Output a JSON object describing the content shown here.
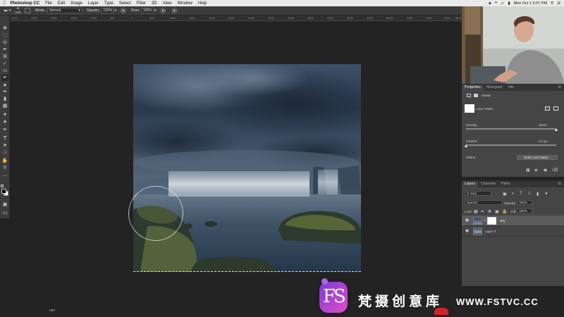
{
  "menubar": {
    "app_name": "Photoshop CC",
    "items": [
      "File",
      "Edit",
      "Image",
      "Layer",
      "Type",
      "Select",
      "Filter",
      "3D",
      "View",
      "Window",
      "Help"
    ],
    "clock": "Mon Oct 1  5:57 PM"
  },
  "options_bar": {
    "brush_size": "1800",
    "mode_label": "Mode:",
    "mode_value": "Normal",
    "opacity_label": "Opacity:",
    "opacity_value": "100%",
    "flow_label": "Flow:",
    "flow_value": "100%"
  },
  "ruler": {
    "ticks": [
      "3000",
      "2500",
      "2000",
      "1500",
      "1000",
      "500",
      "0",
      "500",
      "1000",
      "1500",
      "2000",
      "2500",
      "3000",
      "3500",
      "4000",
      "4500",
      "5000",
      "5500",
      "6000",
      "6500",
      "7000",
      "7500",
      "8000",
      "8500"
    ]
  },
  "properties": {
    "tabs": [
      "Properties",
      "Histogram",
      "Info"
    ],
    "masks_label": "Masks",
    "layer_mask_label": "Layer Mask",
    "density_label": "Density:",
    "density_value": "100%",
    "density_level": 1.0,
    "feather_label": "Feather:",
    "feather_value": "0.0 px",
    "feather_level": 0.0,
    "refine_label": "Refine:",
    "select_and_mask_label": "Select and Mask..."
  },
  "layers_panel": {
    "tabs": [
      "Layers",
      "Channels",
      "Paths"
    ],
    "filter_kind": "Kind",
    "blend_mode": "Normal",
    "opacity_label": "Opacity:",
    "opacity_value": "100%",
    "lock_label": "Lock:",
    "fill_label": "Fill:",
    "fill_value": "100%",
    "layers": [
      {
        "name": "Sky",
        "selected": true,
        "has_mask": true
      },
      {
        "name": "Layer 0",
        "selected": false,
        "has_mask": false
      }
    ]
  },
  "status": {
    "text": "con"
  },
  "watermark": {
    "logo_letters": "FS",
    "chinese_text": "梵摄创意库",
    "url": "WWW.FSTVC.CC"
  },
  "colors": {
    "panel_bg": "#454545",
    "workspace_bg": "#232323",
    "watermark_purple": "#b04ad8"
  }
}
